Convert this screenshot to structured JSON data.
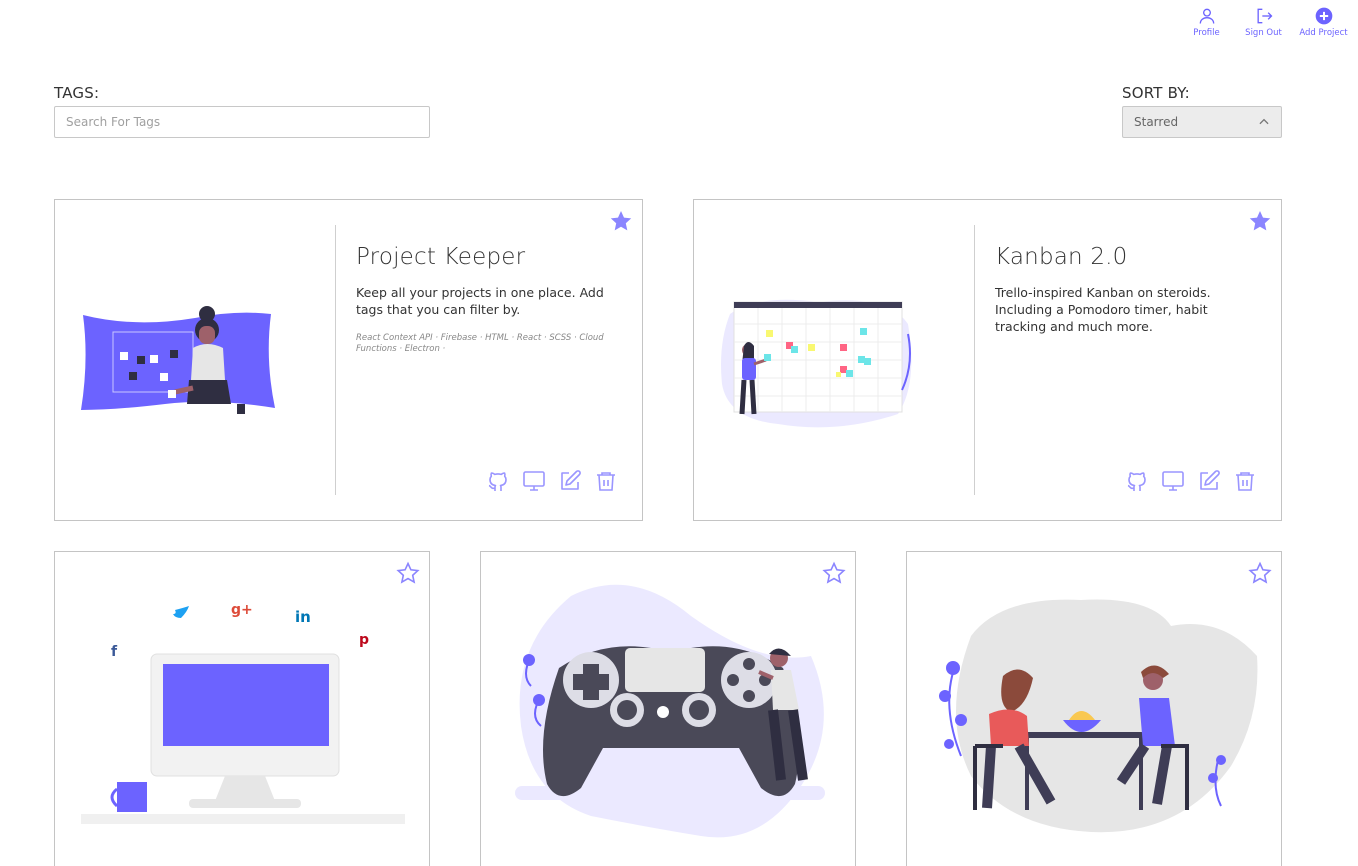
{
  "nav": {
    "profile_label": "Profile",
    "signout_label": "Sign Out",
    "add_project_label": "Add Project"
  },
  "filters": {
    "tags_label": "TAGS:",
    "tags_placeholder": "Search For Tags",
    "sort_label": "SORT BY:",
    "sort_value": "Starred"
  },
  "theme": {
    "accent": "#6c63ff",
    "icon": "#9a95ff"
  },
  "projects": [
    {
      "title": "Project Keeper",
      "description": "Keep all your projects in one place. Add tags that you can filter by.",
      "tags": "React Context API · Firebase · HTML · React · SCSS · Cloud Functions · Electron ·",
      "starred": true,
      "illustration": "woman-at-board-illustration"
    },
    {
      "title": "Kanban 2.0",
      "description": "Trello-inspired Kanban on steroids. Including a Pomodoro timer, habit tracking and much more.",
      "tags": "",
      "starred": true,
      "illustration": "kanban-board-illustration"
    },
    {
      "starred": false,
      "illustration": "social-media-monitor-illustration"
    },
    {
      "starred": false,
      "illustration": "game-controller-illustration"
    },
    {
      "starred": false,
      "illustration": "couple-dinner-illustration"
    }
  ],
  "icons": {
    "profile": "user-icon",
    "signout": "sign-out-icon",
    "add": "plus-circle-icon",
    "star_filled": "star-filled-icon",
    "star_outline": "star-outline-icon",
    "github": "github-icon",
    "demo": "monitor-icon",
    "edit": "edit-icon",
    "delete": "trash-icon"
  }
}
